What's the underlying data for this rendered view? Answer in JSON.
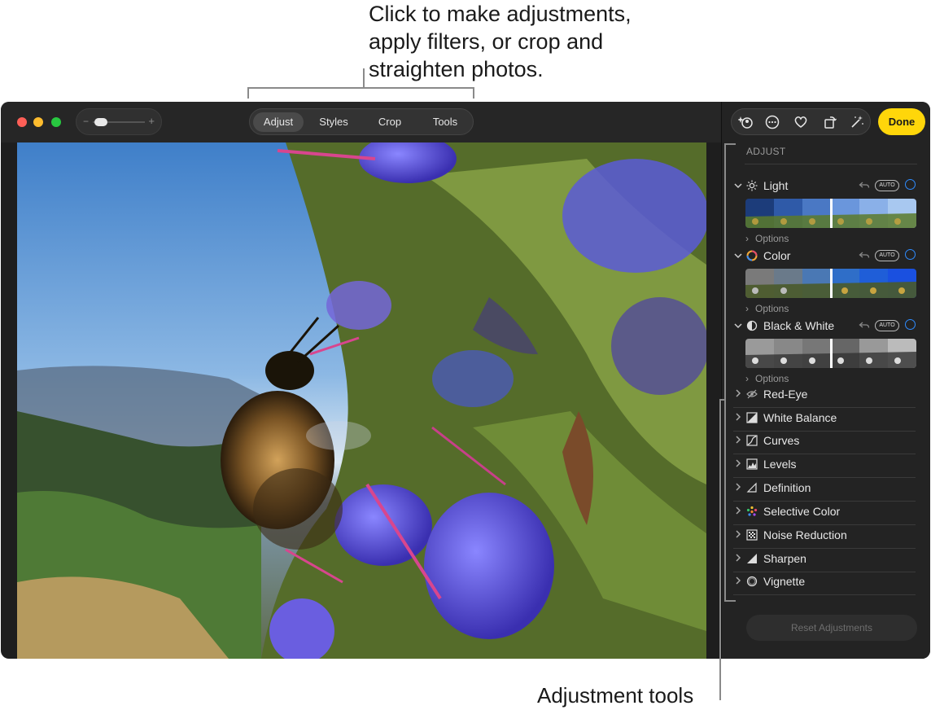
{
  "callouts": {
    "top_lines": [
      "Click to make adjustments,",
      "apply filters, or crop and",
      "straighten photos."
    ],
    "bottom": "Adjustment tools"
  },
  "toolbar": {
    "zoom_minus": "−",
    "zoom_plus": "+",
    "tabs": [
      {
        "label": "Adjust",
        "active": true
      },
      {
        "label": "Styles",
        "active": false
      },
      {
        "label": "Crop",
        "active": false
      },
      {
        "label": "Tools",
        "active": false
      }
    ],
    "icons": [
      "sparkle-person-icon",
      "more-icon",
      "heart-icon",
      "rotate-icon",
      "magic-wand-icon"
    ],
    "done_label": "Done"
  },
  "sidebar": {
    "title": "ADJUST",
    "auto_label": "AUTO",
    "options_label": "Options",
    "sections": [
      {
        "label": "Light",
        "icon": "sun-icon"
      },
      {
        "label": "Color",
        "icon": "color-wheel-icon"
      },
      {
        "label": "Black & White",
        "icon": "half-circle-icon"
      }
    ],
    "tools": [
      {
        "label": "Red-Eye",
        "icon": "eye-slash-icon"
      },
      {
        "label": "White Balance",
        "icon": "white-balance-icon"
      },
      {
        "label": "Curves",
        "icon": "curves-icon"
      },
      {
        "label": "Levels",
        "icon": "levels-icon"
      },
      {
        "label": "Definition",
        "icon": "triangle-icon"
      },
      {
        "label": "Selective Color",
        "icon": "dots-color-icon"
      },
      {
        "label": "Noise Reduction",
        "icon": "noise-icon"
      },
      {
        "label": "Sharpen",
        "icon": "sharpen-icon"
      },
      {
        "label": "Vignette",
        "icon": "vignette-icon"
      }
    ],
    "reset_label": "Reset Adjustments"
  },
  "colors": {
    "accent_blue": "#2f8cff",
    "done_yellow": "#ffd60a"
  }
}
